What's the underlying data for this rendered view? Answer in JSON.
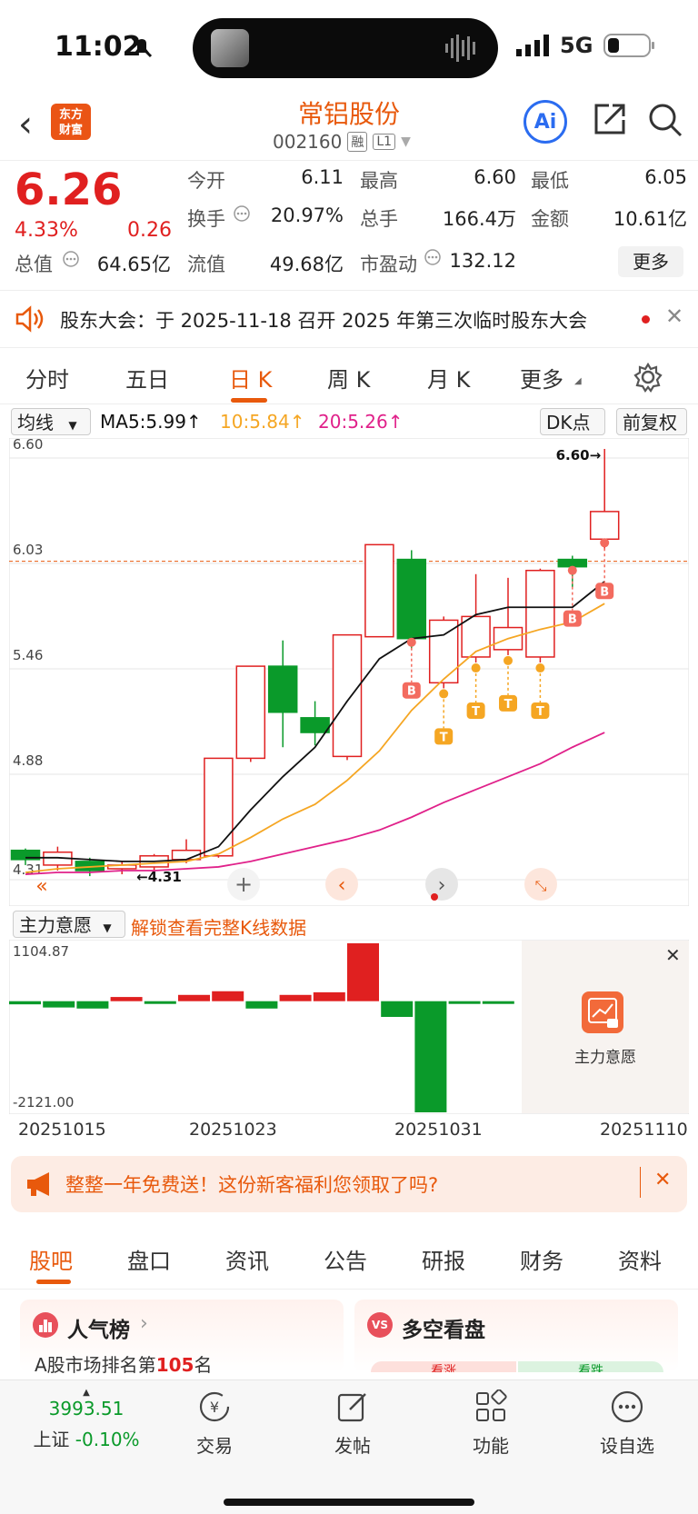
{
  "status_bar": {
    "time": "11:02",
    "network": "5G"
  },
  "header": {
    "logo_text": "东方\n财富",
    "title": "常铝股份",
    "code": "002160",
    "tags": [
      "融",
      "L1"
    ],
    "ai_label": "Ai"
  },
  "quote": {
    "price": "6.26",
    "change_pct": "4.33%",
    "change": "0.26",
    "fields": [
      {
        "label": "今开",
        "value": "6.11",
        "color": "red"
      },
      {
        "label": "最高",
        "value": "6.60",
        "color": "red"
      },
      {
        "label": "最低",
        "value": "6.05",
        "color": "red"
      },
      {
        "label": "换手",
        "value": "20.97%",
        "color": "normal"
      },
      {
        "label": "总手",
        "value": "166.4万",
        "color": "normal"
      },
      {
        "label": "金额",
        "value": "10.61亿",
        "color": "normal"
      },
      {
        "label": "总值",
        "value": "64.65亿",
        "color": "normal"
      },
      {
        "label": "流值",
        "value": "49.68亿",
        "color": "normal"
      },
      {
        "label": "市盈动",
        "value": "132.12",
        "color": "normal"
      }
    ],
    "more_label": "更多"
  },
  "notice": {
    "text": "股东大会：于 2025-11-18 召开 2025 年第三次临时股东大会"
  },
  "kline_tabs": [
    "分时",
    "五日",
    "日 K",
    "周 K",
    "月 K",
    "更多"
  ],
  "ma_bar": {
    "selector": "均线",
    "ma5": "MA5:5.99↑",
    "ma10": "10:5.84↑",
    "ma20": "20:5.26↑",
    "dk": "DK点",
    "adjust": "前复权"
  },
  "chart_data": [
    {
      "type": "candlestick",
      "y_ticks": [
        "6.60",
        "6.03",
        "5.46",
        "4.88",
        "4.31"
      ],
      "ylim": [
        4.31,
        6.6
      ],
      "high_marker": "6.60→",
      "low_marker": "←4.31",
      "candles": [
        {
          "o": 4.42,
          "c": 4.37,
          "h": 4.43,
          "l": 4.34
        },
        {
          "o": 4.34,
          "c": 4.41,
          "h": 4.44,
          "l": 4.31
        },
        {
          "o": 4.36,
          "c": 4.31,
          "h": 4.38,
          "l": 4.28
        },
        {
          "o": 4.32,
          "c": 4.34,
          "h": 4.36,
          "l": 4.29
        },
        {
          "o": 4.33,
          "c": 4.39,
          "h": 4.4,
          "l": 4.31
        },
        {
          "o": 4.37,
          "c": 4.42,
          "h": 4.48,
          "l": 4.35
        },
        {
          "o": 4.39,
          "c": 4.92,
          "h": 4.92,
          "l": 4.38
        },
        {
          "o": 4.92,
          "c": 5.42,
          "h": 5.42,
          "l": 4.9
        },
        {
          "o": 5.42,
          "c": 5.17,
          "h": 5.56,
          "l": 4.98
        },
        {
          "o": 5.14,
          "c": 5.06,
          "h": 5.23,
          "l": 4.99
        },
        {
          "o": 4.93,
          "c": 5.59,
          "h": 5.59,
          "l": 4.91
        },
        {
          "o": 5.58,
          "c": 6.08,
          "h": 6.08,
          "l": 5.58
        },
        {
          "o": 6.0,
          "c": 5.57,
          "h": 6.05,
          "l": 5.51
        },
        {
          "o": 5.33,
          "c": 5.67,
          "h": 5.69,
          "l": 5.3
        },
        {
          "o": 5.47,
          "c": 5.69,
          "h": 5.92,
          "l": 5.44
        },
        {
          "o": 5.51,
          "c": 5.63,
          "h": 5.9,
          "l": 5.48
        },
        {
          "o": 5.47,
          "c": 5.94,
          "h": 5.95,
          "l": 5.44
        },
        {
          "o": 6.0,
          "c": 5.96,
          "h": 6.02,
          "l": 5.85
        },
        {
          "o": 6.11,
          "c": 6.26,
          "h": 6.6,
          "l": 6.05
        }
      ],
      "series": [
        {
          "name": "MA5",
          "color": "#111111",
          "values": [
            4.38,
            4.38,
            4.37,
            4.36,
            4.36,
            4.37,
            4.44,
            4.64,
            4.82,
            4.98,
            5.23,
            5.46,
            5.57,
            5.59,
            5.7,
            5.74,
            5.74,
            5.74,
            5.88
          ]
        },
        {
          "name": "MA10",
          "color": "#f5a623",
          "values": [
            4.3,
            4.32,
            4.33,
            4.34,
            4.35,
            4.36,
            4.4,
            4.49,
            4.59,
            4.67,
            4.8,
            4.96,
            5.18,
            5.35,
            5.5,
            5.57,
            5.62,
            5.66,
            5.76
          ]
        },
        {
          "name": "MA20",
          "color": "#e0218a",
          "values": [
            4.29,
            4.3,
            4.3,
            4.31,
            4.31,
            4.32,
            4.33,
            4.36,
            4.4,
            4.44,
            4.48,
            4.53,
            4.6,
            4.68,
            4.75,
            4.82,
            4.89,
            4.98,
            5.06
          ]
        }
      ],
      "reference_price": 5.99,
      "signals": [
        {
          "type": "B",
          "index": 12
        },
        {
          "type": "T",
          "index": 13
        },
        {
          "type": "T",
          "index": 14
        },
        {
          "type": "T",
          "index": 15
        },
        {
          "type": "T",
          "index": 16
        },
        {
          "type": "B",
          "index": 17
        },
        {
          "type": "B",
          "index": 18
        }
      ]
    },
    {
      "type": "bar",
      "title": "主力意愿",
      "y_ticks": [
        "1104.87",
        "-2121.00"
      ],
      "ylim": [
        -2121.0,
        1104.87
      ],
      "values": [
        -60,
        -120,
        -140,
        80,
        -50,
        120,
        190,
        -140,
        120,
        170,
        1104.87,
        -300,
        -2121.0,
        -20,
        -20
      ],
      "x_dates": [
        "20251015",
        "20251023",
        "20251031",
        "20251110"
      ]
    }
  ],
  "indicator_bar": {
    "selector": "主力意愿",
    "unlock_text": "解锁查看完整K线数据",
    "panel_label": "主力意愿"
  },
  "promo": {
    "text": "整整一年免费送！这份新客福利您领取了吗?"
  },
  "bottom_tabs": [
    "股吧",
    "盘口",
    "资讯",
    "公告",
    "研报",
    "财务",
    "资料"
  ],
  "cards": {
    "popularity": {
      "title": "人气榜",
      "subtitle_prefix": "A股市场排名第",
      "rank": "105",
      "subtitle_suffix": "名"
    },
    "long_short": {
      "title": "多空看盘",
      "rise": "看涨",
      "fall": "看跌"
    }
  },
  "footer": {
    "index_value": "3993.51",
    "index_name": "上证",
    "index_change": "-0.10%",
    "items": [
      "交易",
      "发帖",
      "功能",
      "设自选"
    ]
  },
  "colors": {
    "accent": "#e8590c",
    "up": "#e02020",
    "down": "#0a9a2a"
  }
}
